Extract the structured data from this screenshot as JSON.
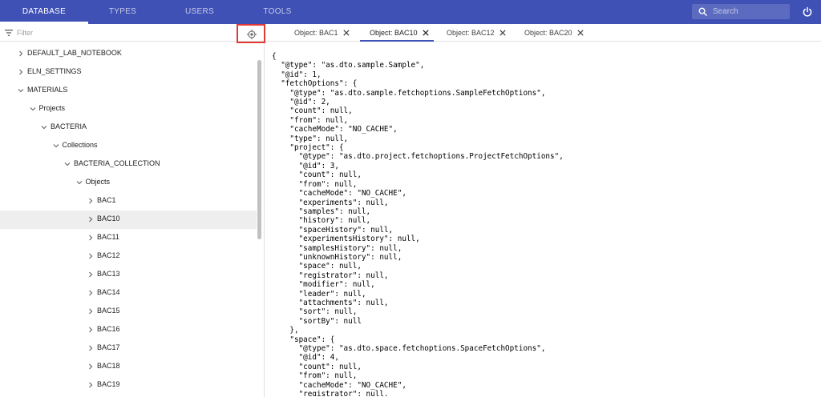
{
  "topnav": {
    "tabs": [
      {
        "label": "DATABASE",
        "active": true
      },
      {
        "label": "TYPES",
        "active": false
      },
      {
        "label": "USERS",
        "active": false
      },
      {
        "label": "TOOLS",
        "active": false
      }
    ],
    "search": {
      "placeholder": "Search",
      "icon": "search-icon"
    },
    "power_icon": "power-icon",
    "colors": {
      "primary": "#3f51b5",
      "search_bg": "#5c6bc0"
    }
  },
  "sidebar": {
    "filter": {
      "placeholder": "Filter",
      "icon": "filter-icon"
    },
    "locate_icon": "crosshair-icon",
    "tree": [
      {
        "label": "DEFAULT_LAB_NOTEBOOK",
        "depth": 0,
        "expanded": false
      },
      {
        "label": "ELN_SETTINGS",
        "depth": 0,
        "expanded": false
      },
      {
        "label": "MATERIALS",
        "depth": 0,
        "expanded": true
      },
      {
        "label": "Projects",
        "depth": 1,
        "expanded": true
      },
      {
        "label": "BACTERIA",
        "depth": 2,
        "expanded": true
      },
      {
        "label": "Collections",
        "depth": 3,
        "expanded": true
      },
      {
        "label": "BACTERIA_COLLECTION",
        "depth": 4,
        "expanded": true
      },
      {
        "label": "Objects",
        "depth": 5,
        "expanded": true
      },
      {
        "label": "BAC1",
        "depth": 6,
        "expanded": false
      },
      {
        "label": "BAC10",
        "depth": 6,
        "expanded": false,
        "selected": true
      },
      {
        "label": "BAC11",
        "depth": 6,
        "expanded": false
      },
      {
        "label": "BAC12",
        "depth": 6,
        "expanded": false
      },
      {
        "label": "BAC13",
        "depth": 6,
        "expanded": false
      },
      {
        "label": "BAC14",
        "depth": 6,
        "expanded": false
      },
      {
        "label": "BAC15",
        "depth": 6,
        "expanded": false
      },
      {
        "label": "BAC16",
        "depth": 6,
        "expanded": false
      },
      {
        "label": "BAC17",
        "depth": 6,
        "expanded": false
      },
      {
        "label": "BAC18",
        "depth": 6,
        "expanded": false
      },
      {
        "label": "BAC19",
        "depth": 6,
        "expanded": false
      }
    ]
  },
  "content": {
    "tabs": [
      {
        "label": "Object: BAC1",
        "active": false
      },
      {
        "label": "Object: BAC10",
        "active": true
      },
      {
        "label": "Object: BAC12",
        "active": false
      },
      {
        "label": "Object: BAC20",
        "active": false
      }
    ],
    "json_lines": [
      "{",
      "  \"@type\": \"as.dto.sample.Sample\",",
      "  \"@id\": 1,",
      "  \"fetchOptions\": {",
      "    \"@type\": \"as.dto.sample.fetchoptions.SampleFetchOptions\",",
      "    \"@id\": 2,",
      "    \"count\": null,",
      "    \"from\": null,",
      "    \"cacheMode\": \"NO_CACHE\",",
      "    \"type\": null,",
      "    \"project\": {",
      "      \"@type\": \"as.dto.project.fetchoptions.ProjectFetchOptions\",",
      "      \"@id\": 3,",
      "      \"count\": null,",
      "      \"from\": null,",
      "      \"cacheMode\": \"NO_CACHE\",",
      "      \"experiments\": null,",
      "      \"samples\": null,",
      "      \"history\": null,",
      "      \"spaceHistory\": null,",
      "      \"experimentsHistory\": null,",
      "      \"samplesHistory\": null,",
      "      \"unknownHistory\": null,",
      "      \"space\": null,",
      "      \"registrator\": null,",
      "      \"modifier\": null,",
      "      \"leader\": null,",
      "      \"attachments\": null,",
      "      \"sort\": null,",
      "      \"sortBy\": null",
      "    },",
      "    \"space\": {",
      "      \"@type\": \"as.dto.space.fetchoptions.SpaceFetchOptions\",",
      "      \"@id\": 4,",
      "      \"count\": null,",
      "      \"from\": null,",
      "      \"cacheMode\": \"NO_CACHE\",",
      "      \"registrator\": null,"
    ]
  }
}
